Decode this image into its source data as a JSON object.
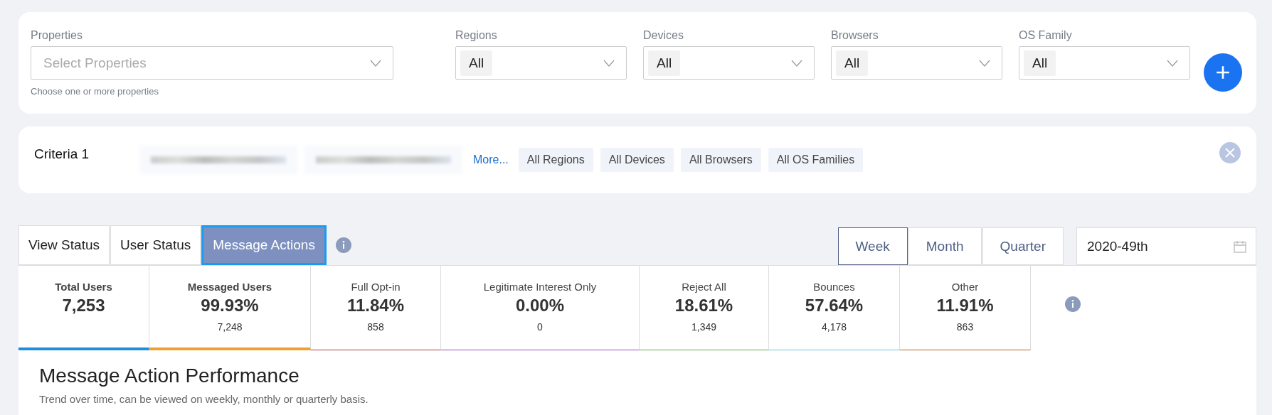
{
  "filters": {
    "properties": {
      "label": "Properties",
      "placeholder": "Select Properties",
      "help": "Choose one or more properties"
    },
    "selects": [
      {
        "label": "Regions",
        "value": "All"
      },
      {
        "label": "Devices",
        "value": "All"
      },
      {
        "label": "Browsers",
        "value": "All"
      },
      {
        "label": "OS Family",
        "value": "All"
      }
    ]
  },
  "criteria": {
    "title": "Criteria 1",
    "items": [
      {
        "kind": "redacted"
      },
      {
        "kind": "redacted"
      },
      {
        "kind": "link",
        "text": "More..."
      },
      {
        "kind": "chip",
        "text": "All Regions"
      },
      {
        "kind": "chip",
        "text": "All Devices"
      },
      {
        "kind": "chip",
        "text": "All Browsers"
      },
      {
        "kind": "chip",
        "text": "All OS Families"
      }
    ]
  },
  "tabs": [
    {
      "label": "View Status",
      "selected": false
    },
    {
      "label": "User Status",
      "selected": false
    },
    {
      "label": "Message Actions",
      "selected": true
    }
  ],
  "periods": [
    {
      "label": "Week",
      "selected": true
    },
    {
      "label": "Month",
      "selected": false
    },
    {
      "label": "Quarter",
      "selected": false
    }
  ],
  "date": {
    "value": "2020-49th"
  },
  "metrics": [
    {
      "label": "Total Users",
      "value": "7,253",
      "selected": true,
      "color": "#1f8ee0"
    },
    {
      "label": "Messaged Users",
      "value": "99.93%",
      "count": "7,248",
      "selected": true,
      "color": "#f0a030"
    },
    {
      "label": "Full Opt-in",
      "value": "11.84%",
      "count": "858",
      "selected": false,
      "color": "#b03a3a"
    },
    {
      "label": "Legitimate Interest Only",
      "value": "0.00%",
      "count": "0",
      "selected": false,
      "color": "#9b4fc0"
    },
    {
      "label": "Reject All",
      "value": "18.61%",
      "count": "1,349",
      "selected": false,
      "color": "#6aa84f"
    },
    {
      "label": "Bounces",
      "value": "57.64%",
      "count": "4,178",
      "selected": false,
      "color": "#5cccd8"
    },
    {
      "label": "Other",
      "value": "11.91%",
      "count": "863",
      "selected": false,
      "color": "#b0662a"
    }
  ],
  "section": {
    "title": "Message Action Performance",
    "subtitle": "Trend over time, can be viewed on weekly, monthly or quarterly basis."
  }
}
